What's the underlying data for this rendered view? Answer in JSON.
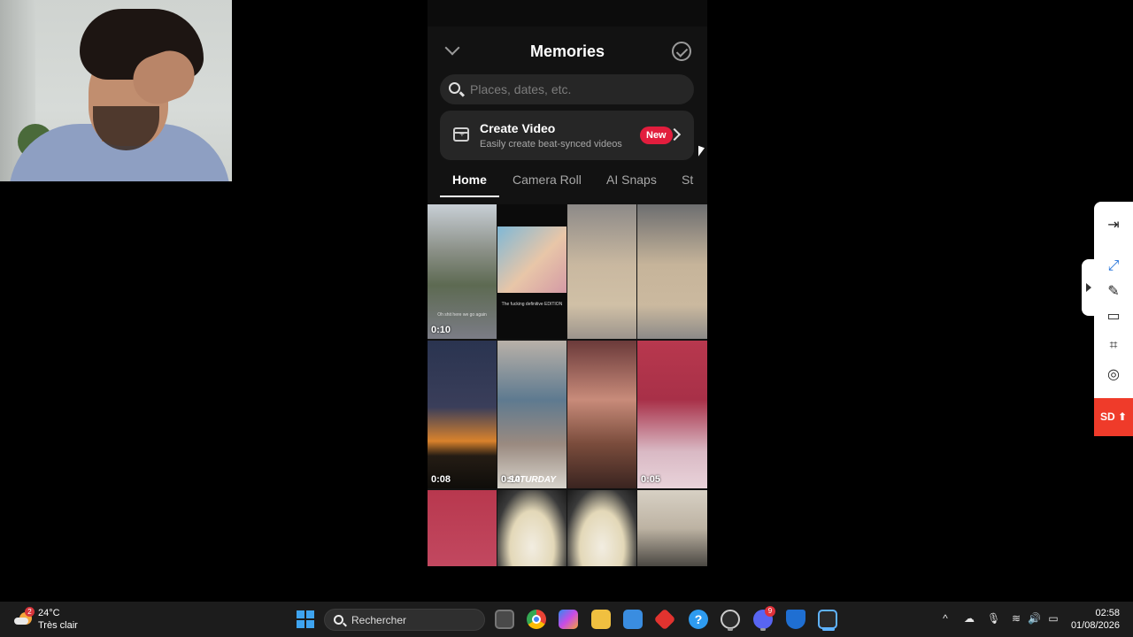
{
  "app": {
    "title": "Memories",
    "search_placeholder": "Places, dates, etc.",
    "create_video": {
      "title": "Create Video",
      "subtitle": "Easily create beat-synced videos",
      "badge": "New"
    },
    "tabs": [
      {
        "label": "Home",
        "active": true
      },
      {
        "label": "Camera Roll",
        "active": false
      },
      {
        "label": "AI Snaps",
        "active": false
      },
      {
        "label": "St",
        "active": false
      }
    ],
    "grid": [
      {
        "duration": "0:10",
        "caption": "Oh shit here we go again"
      },
      {
        "duration": "",
        "caption": "The fucking definitive EDITION"
      },
      {
        "duration": "",
        "caption": ""
      },
      {
        "duration": "",
        "caption": ""
      },
      {
        "duration": "0:08",
        "caption": ""
      },
      {
        "duration": "0:10",
        "caption": "SATURDAY"
      },
      {
        "duration": "",
        "caption": ""
      },
      {
        "duration": "0:05",
        "caption": ""
      },
      {
        "duration": "",
        "caption": ""
      },
      {
        "duration": "",
        "caption": ""
      },
      {
        "duration": "",
        "caption": ""
      },
      {
        "duration": "",
        "caption": ""
      }
    ],
    "accent_color": "#e21d3d"
  },
  "toolbar": {
    "buttons": [
      "exit-icon",
      "fullscreen-icon",
      "pen-icon",
      "window-icon",
      "crop-icon",
      "record-icon"
    ],
    "sd_label": "SD"
  },
  "taskbar": {
    "weather": {
      "badge": "2",
      "temperature": "24°C",
      "condition": "Très clair"
    },
    "search_label": "Rechercher",
    "discord_badge": "9",
    "time": "02:58",
    "date": "01/08/2026"
  }
}
